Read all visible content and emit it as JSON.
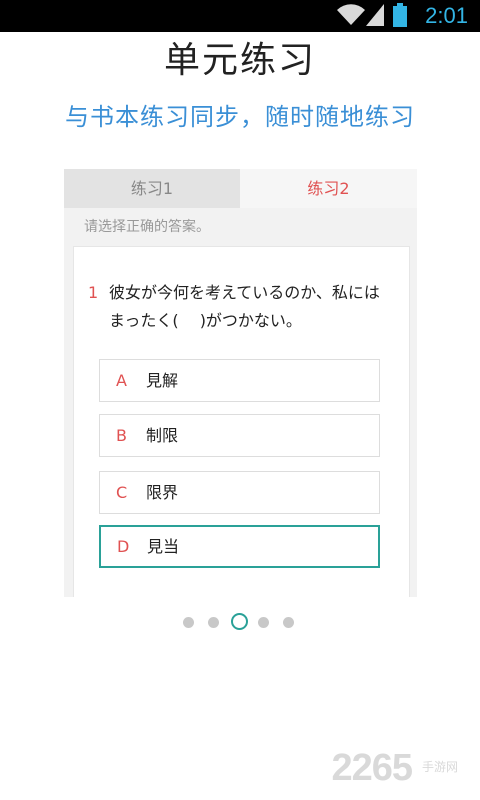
{
  "status_bar": {
    "time": "2:01",
    "icons": [
      "wifi-icon",
      "signal-icon",
      "battery-icon"
    ],
    "time_color": "#33b5e5"
  },
  "header": {
    "title": "单元练习",
    "subtitle": "与书本练习同步，随时随地练习",
    "subtitle_color": "#3a8fd6"
  },
  "preview": {
    "tabs": [
      {
        "label": "练习1",
        "active": false
      },
      {
        "label": "练习2",
        "active": true
      }
    ],
    "instruction": "请选择正确的答案。",
    "question": {
      "number": "1",
      "text": "彼女が今何を考えているのか、私にはまったく(　 )がつかない。"
    },
    "options": [
      {
        "letter": "A",
        "text": "見解",
        "selected": false
      },
      {
        "letter": "B",
        "text": "制限",
        "selected": false
      },
      {
        "letter": "C",
        "text": "限界",
        "selected": false
      },
      {
        "letter": "D",
        "text": "見当",
        "selected": true
      }
    ],
    "accent_color": "#e05252",
    "selected_border_color": "#2aa198"
  },
  "pager": {
    "count": 5,
    "active_index": 2
  },
  "watermark": {
    "number": "2265",
    "suffix": "手游网"
  }
}
